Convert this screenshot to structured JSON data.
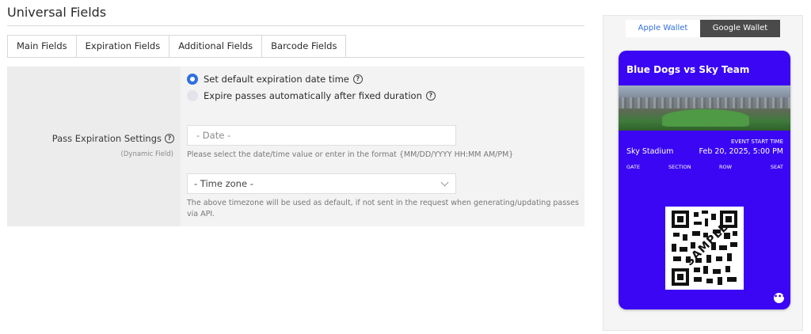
{
  "page": {
    "title": "Universal Fields"
  },
  "tabs": [
    {
      "label": "Main Fields"
    },
    {
      "label": "Expiration Fields",
      "active": true
    },
    {
      "label": "Additional Fields"
    },
    {
      "label": "Barcode Fields"
    }
  ],
  "form": {
    "label": "Pass Expiration Settings",
    "sublabel": "(Dynamic Field)",
    "options": [
      {
        "label": "Set default expiration date time",
        "selected": true
      },
      {
        "label": "Expire passes automatically after fixed duration",
        "selected": false
      }
    ],
    "date_placeholder": "- Date -",
    "date_hint": "Please select the date/time value or enter in the format {MM/DD/YYYY HH:MM AM/PM}",
    "timezone_value": "- Time zone -",
    "timezone_hint": "The above timezone will be used as default, if not sent in the request when generating/updating passes via API."
  },
  "preview": {
    "tabs": [
      {
        "label": "Apple Wallet",
        "active": true
      },
      {
        "label": "Google Wallet",
        "active": false
      }
    ],
    "pass": {
      "title": "Blue Dogs vs Sky Team",
      "event_label": "EVENT START TIME",
      "venue": "Sky Stadium",
      "date": "Feb 20, 2025, 5:00 PM",
      "seat_fields": [
        "GATE",
        "SECTION",
        "ROW",
        "SEAT"
      ],
      "barcode_stamp": "SAMPLE",
      "background_color": "#3a06f4"
    }
  },
  "colors": {
    "accent": "#2f6fe0",
    "pass_bg": "#3a06f4",
    "dark_tab": "#4a4a4a"
  },
  "icons": [
    "help-icon",
    "radio-selected-icon",
    "radio-unselected-icon",
    "chevron-down-icon",
    "qr-code-icon",
    "more-icon"
  ]
}
